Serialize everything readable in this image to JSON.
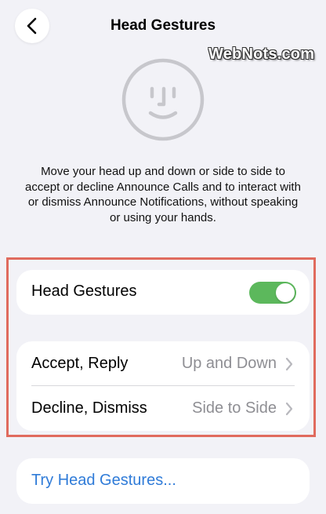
{
  "nav": {
    "title": "Head Gestures",
    "back_icon": "chevron-left-icon"
  },
  "watermark": "WebNots.com",
  "hero": {
    "icon": "face-icon",
    "description": "Move your head up and down or side to side to accept or decline Announce Calls and to interact with or dismiss Announce Notifications, without speaking or using your hands."
  },
  "toggle_row": {
    "label": "Head Gestures",
    "enabled": true,
    "accent": "#5cb85c"
  },
  "options": [
    {
      "label": "Accept, Reply",
      "value": "Up and Down"
    },
    {
      "label": "Decline, Dismiss",
      "value": "Side to Side"
    }
  ],
  "try_link": {
    "label": "Try Head Gestures...",
    "color": "#2f7bd8"
  },
  "highlight_color": "#e06b5e"
}
